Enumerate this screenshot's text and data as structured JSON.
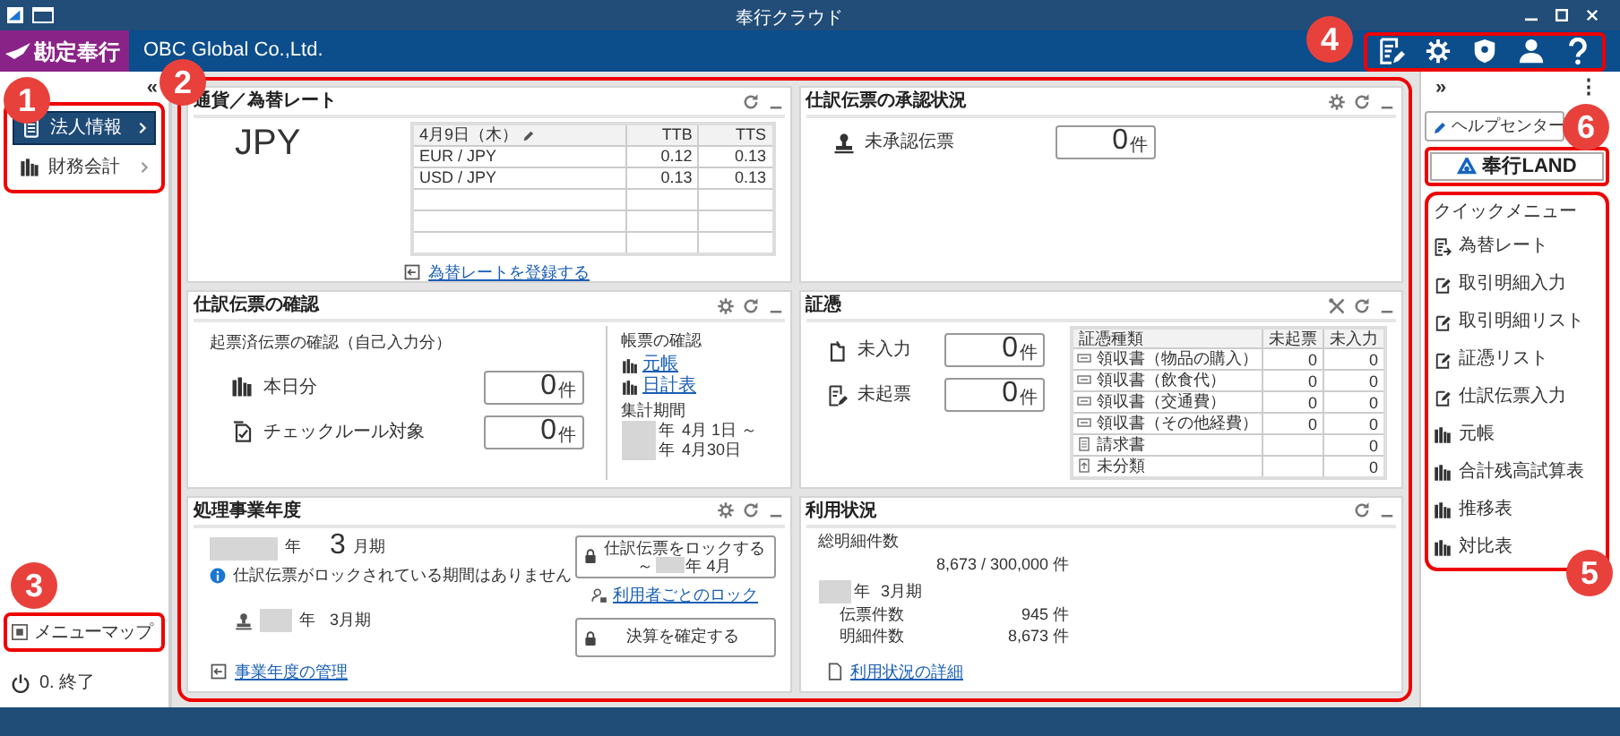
{
  "window": {
    "title": "奉行クラウド"
  },
  "header": {
    "product": "勘定奉行",
    "company": "OBC Global Co.,Ltd."
  },
  "sidebar": {
    "collapse": "«",
    "items": [
      {
        "label": "法人情報",
        "kind": "company",
        "selected": true
      },
      {
        "label": "財務会計",
        "kind": "books",
        "selected": false
      }
    ],
    "menu_map": "メニューマップ",
    "exit": "0. 終了"
  },
  "exchange_rate": {
    "title": "通貨／為替レート",
    "currency": "JPY",
    "columns": [
      "4月9日（木）",
      "TTB",
      "TTS"
    ],
    "rows": [
      [
        "EUR / JPY",
        "0.12",
        "0.13"
      ],
      [
        "USD / JPY",
        "0.13",
        "0.13"
      ]
    ],
    "link": "為替レートを登録する"
  },
  "approval": {
    "title": "仕訳伝票の承認状況",
    "counters": [
      {
        "label": "未承認伝票",
        "kind": "stamp",
        "count": "0",
        "unit": "件"
      }
    ]
  },
  "slip_check": {
    "title": "仕訳伝票の確認",
    "subtitle": "起票済伝票の確認（自己入力分）",
    "counters": [
      {
        "label": "本日分",
        "kind": "books",
        "count": "0",
        "unit": "件"
      },
      {
        "label": "チェックルール対象",
        "kind": "check",
        "count": "0",
        "unit": "件"
      }
    ],
    "reports_title": "帳票の確認",
    "reports": [
      "元帳",
      "日計表"
    ],
    "period_title": "集計期間",
    "period": [
      {
        "year": "年",
        "date": "4月 1日 ～"
      },
      {
        "year": "年",
        "date": "4月30日"
      }
    ]
  },
  "evidence": {
    "title": "証憑",
    "counters": [
      {
        "label": "未入力",
        "kind": "upload",
        "count": "0",
        "unit": "件"
      },
      {
        "label": "未起票",
        "kind": "draft",
        "count": "0",
        "unit": "件"
      }
    ],
    "columns": [
      "証憑種類",
      "未起票",
      "未入力"
    ],
    "rows": [
      {
        "kind": "receipt",
        "name": "領収書（物品の購入）",
        "unposted": "0",
        "unentered": "0"
      },
      {
        "kind": "receipt",
        "name": "領収書（飲食代）",
        "unposted": "0",
        "unentered": "0"
      },
      {
        "kind": "receipt",
        "name": "領収書（交通費）",
        "unposted": "0",
        "unentered": "0"
      },
      {
        "kind": "receipt",
        "name": "領収書（その他経費）",
        "unposted": "0",
        "unentered": "0"
      },
      {
        "kind": "invoice",
        "name": "請求書",
        "unentered": "0"
      },
      {
        "kind": "unsorted",
        "name": "未分類",
        "unentered": "0"
      }
    ]
  },
  "fiscal_year": {
    "title": "処理事業年度",
    "year_suffix": "年",
    "period": "3",
    "period_unit": "月期",
    "lock_notice": "仕訳伝票がロックされている期間はありません",
    "closing_year_suffix": "年",
    "closing_period": "3月期",
    "lock_button": {
      "line1": "仕訳伝票をロックする",
      "prefix": "～",
      "suffix": "年 4月"
    },
    "user_lock_link": "利用者ごとのロック",
    "close_button": "決算を確定する",
    "manage_link": "事業年度の管理"
  },
  "usage": {
    "title": "利用状況",
    "total_label": "総明細件数",
    "total": "8,673 / 300,000 件",
    "year_suffix": "年",
    "period": "3月期",
    "stats": [
      {
        "label": "伝票件数",
        "value": "945 件"
      },
      {
        "label": "明細件数",
        "value": "8,673 件"
      }
    ],
    "link": "利用状況の詳細"
  },
  "right_panel": {
    "expand": "»",
    "more": "⋮",
    "help_button": "ヘルプセンター",
    "land_button": "奉行LAND",
    "quick_menu_title": "クイックメニュー",
    "quick_menu": [
      {
        "label": "為替レート",
        "kind": "list"
      },
      {
        "label": "取引明細入力",
        "kind": "entry"
      },
      {
        "label": "取引明細リスト",
        "kind": "entry"
      },
      {
        "label": "証憑リスト",
        "kind": "entry"
      },
      {
        "label": "仕訳伝票入力",
        "kind": "entry"
      },
      {
        "label": "元帳",
        "kind": "books"
      },
      {
        "label": "合計残高試算表",
        "kind": "books"
      },
      {
        "label": "推移表",
        "kind": "books"
      },
      {
        "label": "対比表",
        "kind": "books"
      }
    ]
  },
  "callouts": {
    "sidebar": "1",
    "dashboard": "2",
    "menu_map": "3",
    "toolbar": "4",
    "quick_menu": "5",
    "land": "6"
  }
}
